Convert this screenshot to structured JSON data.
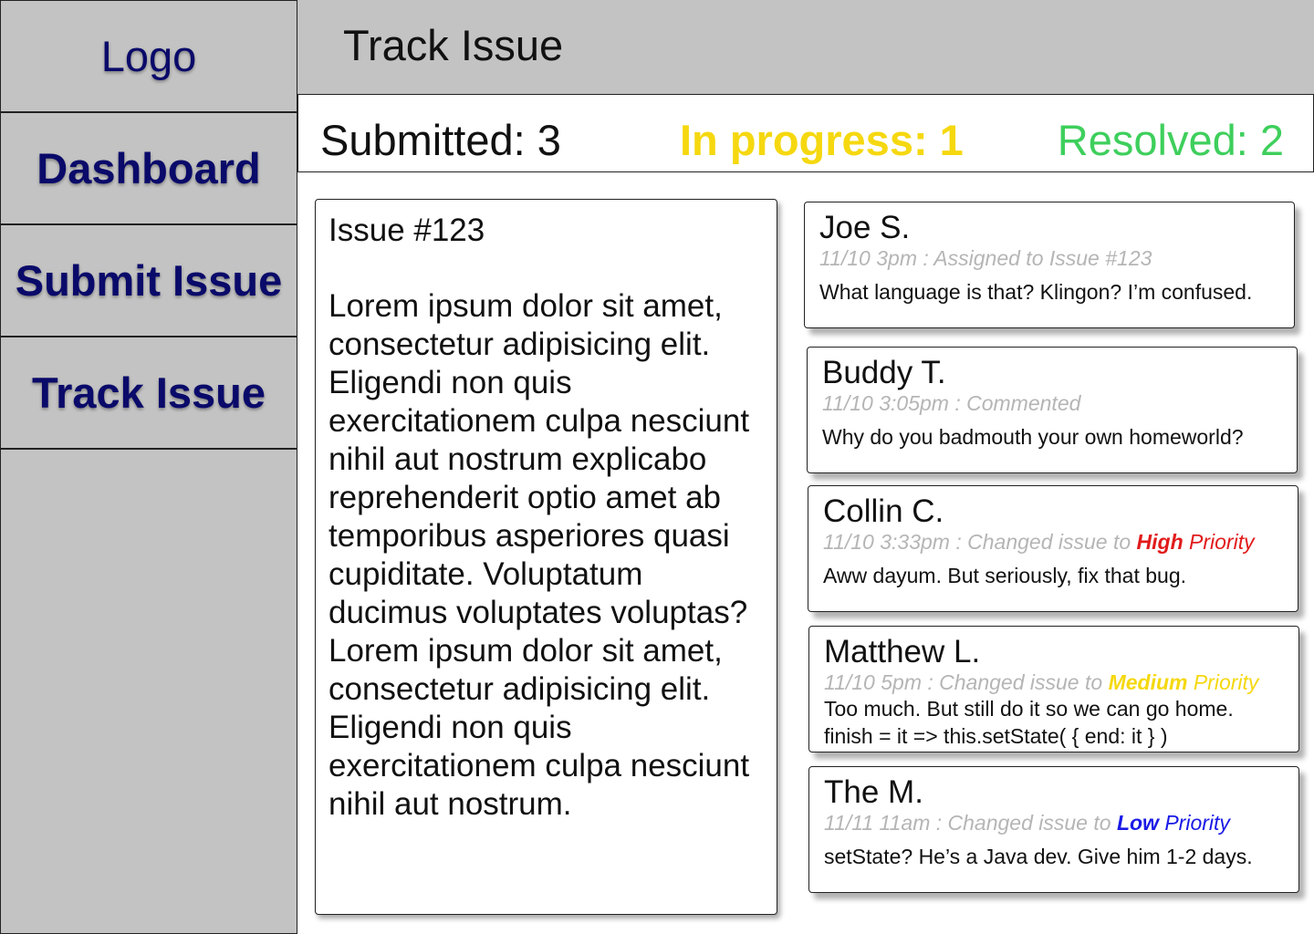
{
  "sidebar": {
    "items": [
      {
        "label": "Logo"
      },
      {
        "label": "Dashboard"
      },
      {
        "label": "Submit Issue"
      },
      {
        "label": "Track Issue"
      }
    ]
  },
  "header": {
    "title": "Track Issue"
  },
  "stats": {
    "submitted": "Submitted: 3",
    "in_progress": "In progress: 1",
    "resolved": "Resolved: 2"
  },
  "issue": {
    "title": "Issue #123",
    "body": "Lorem ipsum dolor sit amet, consectetur adipisicing elit. Eligendi non quis exercitationem culpa nesciunt nihil aut nostrum explicabo reprehenderit optio amet ab temporibus asperiores quasi cupiditate. Voluptatum ducimus voluptates voluptas?\nLorem ipsum dolor sit amet, consectetur adipisicing elit. Eligendi non quis exercitationem culpa nesciunt nihil aut nostrum."
  },
  "comments": [
    {
      "author": "Joe S.",
      "meta": "11/10  3pm :  Assigned to Issue #123",
      "text": "What language is that? Klingon? I’m confused."
    },
    {
      "author": "Buddy T.",
      "meta": "11/10  3:05pm :  Commented",
      "text": "Why do you badmouth your own homeworld?"
    },
    {
      "author": "Collin C.",
      "meta": "11/10  3:33pm :  Changed issue to ",
      "priority_word": "High",
      "priority_suffix": " Priority",
      "text": "Aww dayum. But seriously, fix that bug."
    },
    {
      "author": "Matthew L.",
      "meta": "11/10  5pm : Changed issue to ",
      "priority_word": "Medium",
      "priority_suffix": " Priority",
      "text": "Too much. But still do it so we can go home.",
      "text2": "finish = it => this.setState( { end: it } )"
    },
    {
      "author": "The M.",
      "meta": "11/11  11am :  Changed issue to ",
      "priority_word": "Low",
      "priority_suffix": " Priority",
      "text": "setState? He’s a Java dev. Give him 1-2 days."
    }
  ],
  "colors": {
    "panel_gray": "#c3c3c3",
    "nav_text": "#0a0a6a",
    "in_progress": "#f5d80f",
    "resolved": "#3ecf5c",
    "high": "#e11b1b",
    "medium": "#f5d80f",
    "low": "#1a1ae6"
  }
}
